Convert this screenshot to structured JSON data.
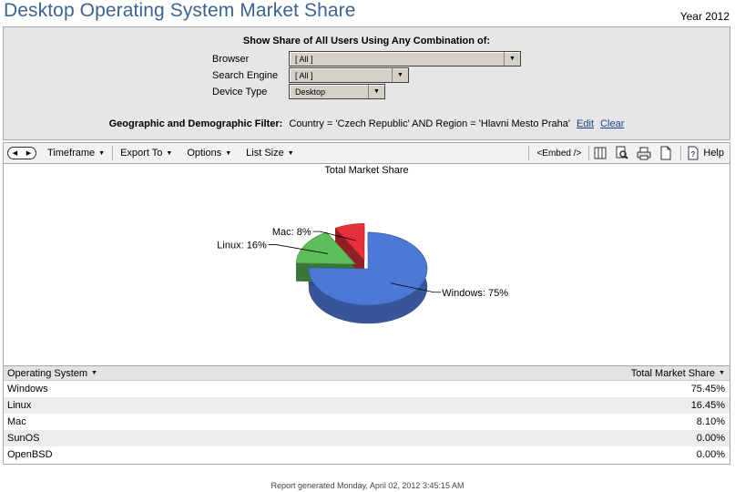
{
  "header": {
    "title": "Desktop Operating System Market Share",
    "year": "Year 2012"
  },
  "filters": {
    "heading": "Show Share of All Users Using Any Combination of:",
    "browser": {
      "label": "Browser",
      "value": "[ All ]"
    },
    "search_engine": {
      "label": "Search Engine",
      "value": "[ All ]"
    },
    "device_type": {
      "label": "Device Type",
      "value": "Desktop"
    },
    "geo_label": "Geographic and Demographic Filter:",
    "geo_value": "Country = 'Czech Republic' AND Region = 'Hlavni Mesto Praha'",
    "edit": "Edit",
    "clear": "Clear"
  },
  "toolbar": {
    "timeframe": "Timeframe",
    "export": "Export To",
    "options": "Options",
    "list_size": "List Size",
    "embed": "<Embed />",
    "help": "Help"
  },
  "chart_data": {
    "type": "pie",
    "title": "Total Market Share",
    "slices": [
      {
        "label": "Windows",
        "value": 75.45,
        "display": "Windows: 75%",
        "color": "#4d78d6"
      },
      {
        "label": "Linux",
        "value": 16.45,
        "display": "Linux: 16%",
        "color": "#5cbf5c"
      },
      {
        "label": "Mac",
        "value": 8.1,
        "display": "Mac: 8%",
        "color": "#e8303c"
      }
    ]
  },
  "table": {
    "col1": "Operating System",
    "col2": "Total Market Share",
    "rows": [
      {
        "os": "Windows",
        "share": "75.45%"
      },
      {
        "os": "Linux",
        "share": "16.45%"
      },
      {
        "os": "Mac",
        "share": "8.10%"
      },
      {
        "os": "SunOS",
        "share": "0.00%"
      },
      {
        "os": "OpenBSD",
        "share": "0.00%"
      }
    ]
  },
  "footer": "Report generated Monday, April 02, 2012 3:45:15 AM"
}
